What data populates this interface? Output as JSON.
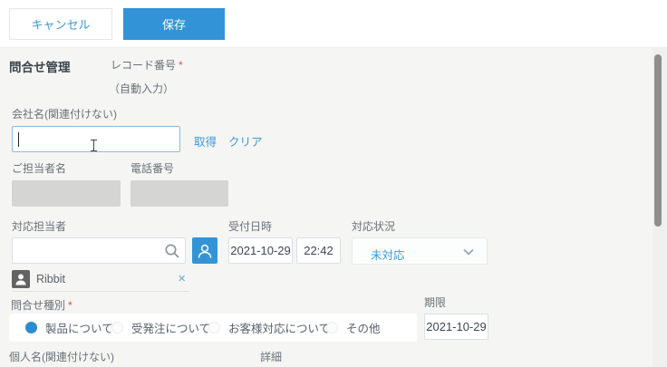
{
  "toolbar": {
    "cancel_label": "キャンセル",
    "save_label": "保存"
  },
  "app": {
    "title": "問合せ管理"
  },
  "record_number": {
    "label": "レコード番号",
    "required_mark": "*",
    "auto_note": "（自動入力）"
  },
  "company": {
    "label": "会社名(関連付けない)",
    "value": "",
    "get_link": "取得",
    "clear_link": "クリア"
  },
  "contact_name": {
    "label": "ご担当者名",
    "value": ""
  },
  "phone": {
    "label": "電話番号",
    "value": ""
  },
  "assignee": {
    "label": "対応担当者",
    "value": "",
    "selected_user": "Ribbit",
    "remove_glyph": "×"
  },
  "received": {
    "label": "受付日時",
    "date": "2021-10-29",
    "time": "22:42"
  },
  "status": {
    "label": "対応状況",
    "value": "未対応"
  },
  "inquiry_type": {
    "label": "問合せ種別",
    "required_mark": "*",
    "options": [
      {
        "label": "製品について",
        "selected": true
      },
      {
        "label": "受発注について",
        "selected": false
      },
      {
        "label": "お客様対応について",
        "selected": false
      },
      {
        "label": "その他",
        "selected": false
      }
    ]
  },
  "deadline": {
    "label": "期限",
    "value": "2021-10-29"
  },
  "personal_name": {
    "label": "個人名(関連付けない)"
  },
  "detail": {
    "label": "詳細"
  },
  "colors": {
    "accent_blue": "#3294d6",
    "link_blue": "#3b99d9",
    "required_red": "#e0513b",
    "page_bg": "#f5f5f3",
    "disabled_gray": "#d5d5d4"
  }
}
